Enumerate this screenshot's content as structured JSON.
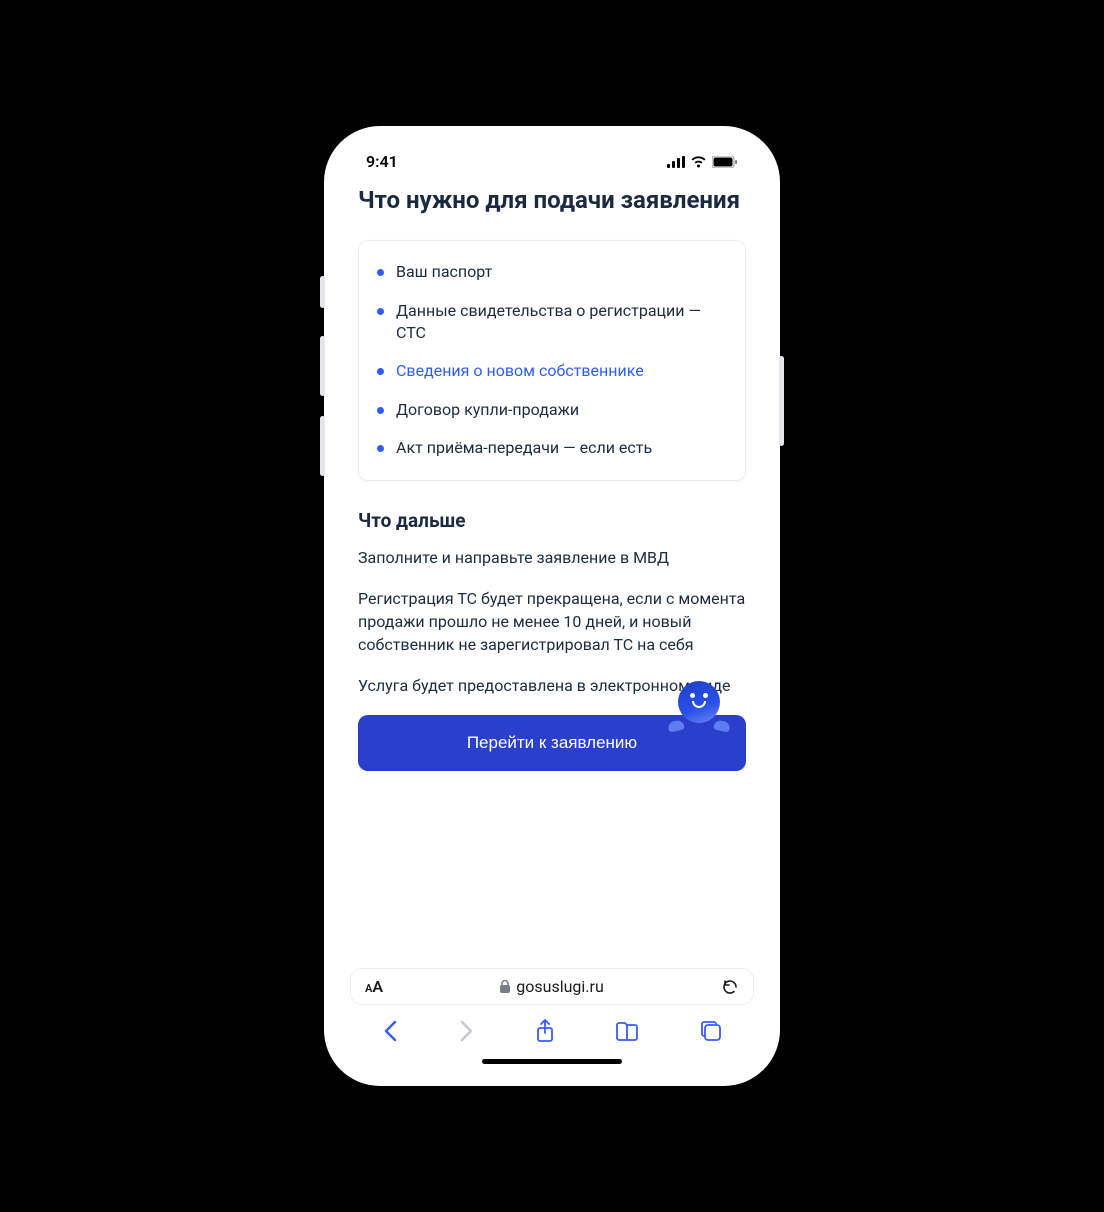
{
  "status": {
    "time": "9:41"
  },
  "page": {
    "title": "Что нужно для подачи заявления",
    "requirements": [
      {
        "text": "Ваш паспорт",
        "link": false
      },
      {
        "text": "Данные свидетельства о регистрации — СТС",
        "link": false
      },
      {
        "text": "Сведения о новом собственнике",
        "link": true
      },
      {
        "text": "Договор купли-продажи",
        "link": false
      },
      {
        "text": "Акт приёма-передачи — если есть",
        "link": false
      }
    ],
    "next_heading": "Что дальше",
    "paragraphs": [
      "Заполните и направьте заявление в МВД",
      "Регистрация ТС будет прекращена, если с момента продажи прошло не менее 10 дней, и новый собственник не зарегистрировал ТС на себя",
      "Услуга будет предоставлена в электронном виде"
    ],
    "cta_label": "Перейти к заявлению"
  },
  "browser": {
    "font_scale_label": "AA",
    "url": "gosuslugi.ru"
  }
}
